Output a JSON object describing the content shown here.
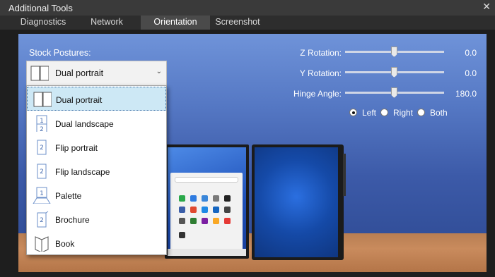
{
  "window": {
    "title": "Additional Tools",
    "close": "✕"
  },
  "tabs": [
    {
      "label": "Diagnostics"
    },
    {
      "label": "Network"
    },
    {
      "label": "Orientation",
      "active": true
    },
    {
      "label": "Screenshot"
    }
  ],
  "postures": {
    "label": "Stock Postures:",
    "selected": "Dual portrait",
    "options": [
      {
        "label": "Dual portrait",
        "icon": "dual-portrait-icon"
      },
      {
        "label": "Dual landscape",
        "icon": "dual-landscape-icon"
      },
      {
        "label": "Flip portrait",
        "icon": "flip-portrait-icon"
      },
      {
        "label": "Flip landscape",
        "icon": "flip-landscape-icon"
      },
      {
        "label": "Palette",
        "icon": "palette-icon"
      },
      {
        "label": "Brochure",
        "icon": "brochure-icon"
      },
      {
        "label": "Book",
        "icon": "book-icon"
      }
    ]
  },
  "rotation": {
    "z": {
      "label": "Z Rotation:",
      "value": "0.0"
    },
    "y": {
      "label": "Y Rotation:",
      "value": "0.0"
    },
    "hinge": {
      "label": "Hinge Angle:",
      "value": "180.0"
    },
    "screen_choice": {
      "options": [
        "Left",
        "Right",
        "Both"
      ],
      "selected": "Left"
    }
  },
  "colors": {
    "accent_selected": "#cde8f5",
    "sky": "#5578c4",
    "floor": "#c98b5d"
  }
}
